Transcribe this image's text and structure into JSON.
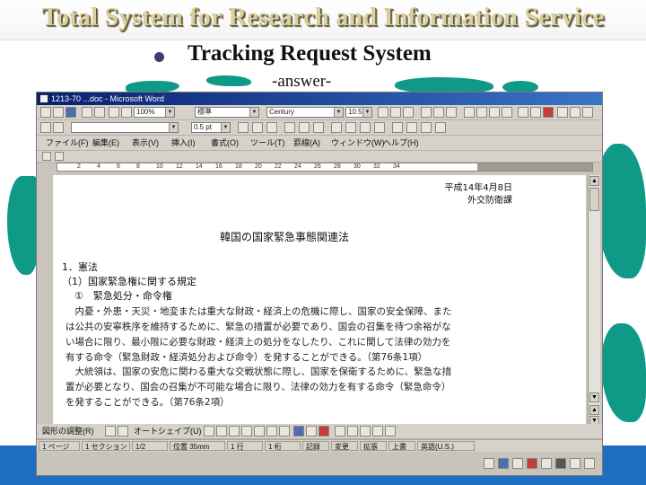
{
  "slide": {
    "title": "Total System for Research and Information Service",
    "bullet": "Tracking Request System",
    "subtitle": "-answer-"
  },
  "window": {
    "title": "1213-70 ...doc - Microsoft Word"
  },
  "toolbar": {
    "zoom": "100%",
    "style": "標準",
    "font": "Century",
    "size": "10.5",
    "size2": "0.5 pt"
  },
  "menu": [
    "ファイル(F)",
    "編集(E)",
    "表示(V)",
    "挿入(I)",
    "書式(O)",
    "ツール(T)",
    "罫線(A)",
    "ウィンドウ(W)",
    "ヘルプ(H)"
  ],
  "ruler": [
    "2",
    "4",
    "6",
    "8",
    "10",
    "12",
    "14",
    "16",
    "18",
    "20",
    "22",
    "24",
    "26",
    "28",
    "30",
    "32",
    "34"
  ],
  "document": {
    "date": "平成14年4月8日",
    "dept": "外交防衛課",
    "title": "韓国の国家緊急事態関連法",
    "sec1": "1．憲法",
    "sec1a": "（1）国家緊急権に関する規定",
    "sec1a1": "①　緊急処分・命令権",
    "para1": "　内憂・外患・天災・地変または重大な財政・経済上の危機に際し、国家の安全保障、または公共の安寧秩序を維持するために、緊急の措置が必要であり、国会の召集を待つ余裕がない場合に限り、最小限に必要な財政・経済上の処分をなしたり、これに関して法律の効力を有する命令（緊急財政・経済処分および命令）を発することができる。（第76条1項）",
    "para2": "　大統領は、国家の安危に関わる重大な交戦状態に際し、国家を保衛するために、緊急な措置が必要となり、国会の召集が不可能な場合に限り、法律の効力を有する命令（緊急命令）を発することができる。（第76条2項）"
  },
  "status": {
    "page": "1 ページ",
    "section": "1 セクション",
    "pages": "1/2",
    "position": "位置 35mm",
    "line": "1 行",
    "col": "1 桁",
    "rec": "記録",
    "trk": "変更",
    "ext": "拡張",
    "ovr": "上書",
    "lang": "英語(U.S.)"
  },
  "drawing": {
    "draw": "図形の調整(R)",
    "autoshape": "オートシェイプ(U)"
  },
  "colors": {
    "title_gold": "#d9d0a0",
    "land_teal": "#0f9a88",
    "footer_blue": "#1f6fc0",
    "titlebar_blue": "#08206e"
  }
}
